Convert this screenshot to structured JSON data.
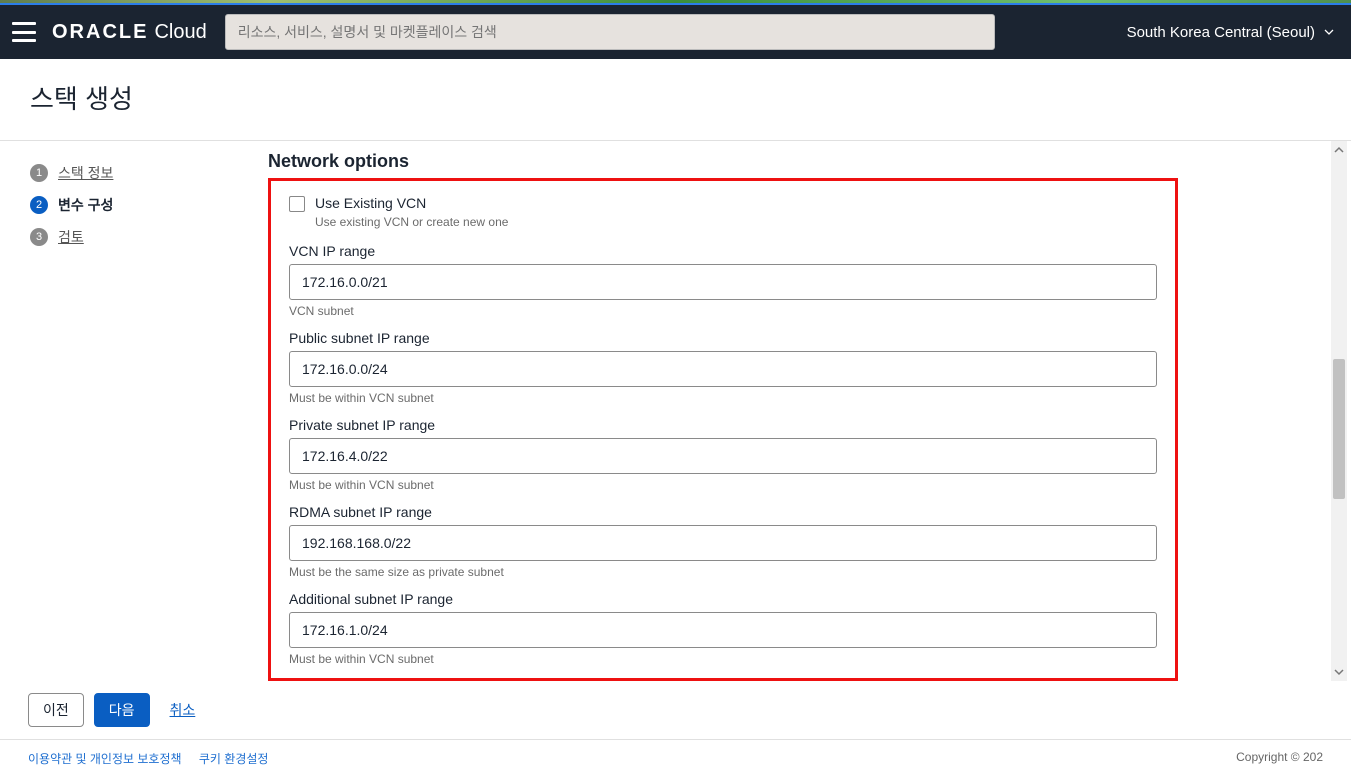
{
  "header": {
    "logo_brand": "ORACLE",
    "logo_product": "Cloud",
    "search_placeholder": "리소스, 서비스, 설명서 및 마켓플레이스 검색",
    "region": "South Korea Central (Seoul)"
  },
  "page_title": "스택 생성",
  "steps": [
    {
      "num": "1",
      "label": "스택 정보",
      "state": "done"
    },
    {
      "num": "2",
      "label": "변수 구성",
      "state": "active"
    },
    {
      "num": "3",
      "label": "검토",
      "state": "future"
    }
  ],
  "form": {
    "section_title": "Network options",
    "use_existing_vcn": {
      "label": "Use Existing VCN",
      "help": "Use existing VCN or create new one",
      "checked": false
    },
    "fields": [
      {
        "label": "VCN IP range",
        "value": "172.16.0.0/21",
        "help": "VCN subnet"
      },
      {
        "label": "Public subnet IP range",
        "value": "172.16.0.0/24",
        "help": "Must be within VCN subnet"
      },
      {
        "label": "Private subnet IP range",
        "value": "172.16.4.0/22",
        "help": "Must be within VCN subnet"
      },
      {
        "label": "RDMA subnet IP range",
        "value": "192.168.168.0/22",
        "help": "Must be the same size as private subnet"
      },
      {
        "label": "Additional subnet IP range",
        "value": "172.16.1.0/24",
        "help": "Must be within VCN subnet"
      }
    ]
  },
  "footer": {
    "prev": "이전",
    "next": "다음",
    "cancel": "취소"
  },
  "legal": {
    "terms": "이용약관 및 개인정보 보호정책",
    "cookies": "쿠키 환경설정",
    "copyright": "Copyright © 202"
  }
}
